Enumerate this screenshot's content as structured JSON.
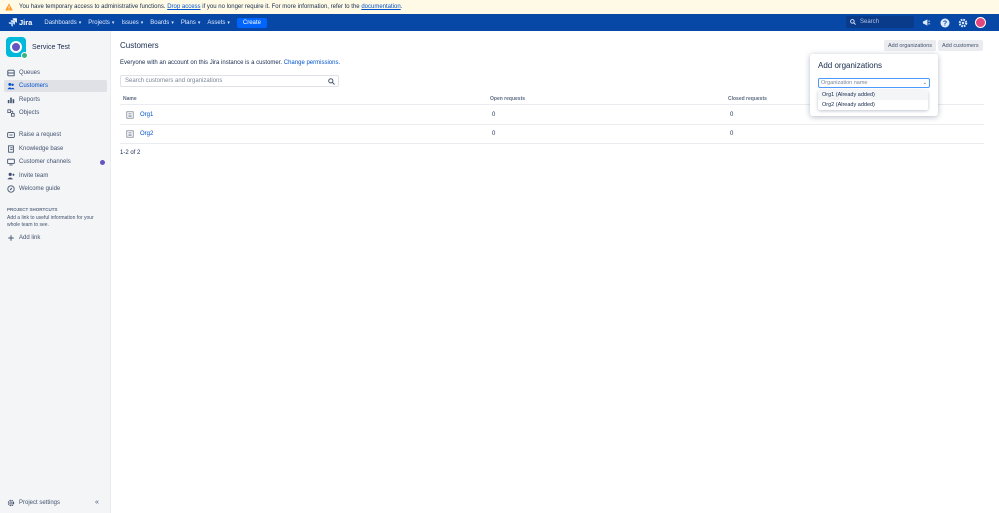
{
  "banner": {
    "text_before": "You have temporary access to administrative functions.",
    "drop_link": "Drop access",
    "text_middle": "if you no longer require it. For more information, refer to the",
    "doc_link": "documentation",
    "text_after": "."
  },
  "topnav": {
    "logo": "Jira",
    "items": [
      "Dashboards",
      "Projects",
      "Issues",
      "Boards",
      "Plans",
      "Assets"
    ],
    "create_label": "Create",
    "search_placeholder": "Search"
  },
  "sidebar": {
    "project_name": "Service Test",
    "items": [
      "Queues",
      "Customers",
      "Reports",
      "Objects"
    ],
    "items2": [
      "Raise a request",
      "Knowledge base",
      "Customer channels",
      "Invite team",
      "Welcome guide"
    ],
    "shortcuts_title": "PROJECT SHORTCUTS",
    "shortcuts_text": "Add a link to useful information for your whole team to see.",
    "add_link": "Add link",
    "project_settings": "Project settings",
    "collapse": "«"
  },
  "main": {
    "title": "Customers",
    "add_orgs_button": "Add organizations",
    "add_customers_button": "Add customers",
    "desc_text": "Everyone with an account on this Jira instance is a customer.",
    "change_permissions": "Change permissions.",
    "search_placeholder": "Search customers and organizations",
    "columns": [
      "Name",
      "Open requests",
      "Closed requests"
    ],
    "rows": [
      {
        "name": "Org1",
        "open": "0",
        "closed": "0"
      },
      {
        "name": "Org2",
        "open": "0",
        "closed": "0"
      }
    ],
    "count": "1-2 of 2"
  },
  "popup": {
    "title": "Add organizations",
    "placeholder": "Organization name",
    "options": [
      "Org1 (Already added)",
      "Org2 (Already added)"
    ]
  },
  "colors": {
    "nav_bg": "#0747a6",
    "accent": "#0052cc",
    "banner_bg": "#fffae6"
  }
}
